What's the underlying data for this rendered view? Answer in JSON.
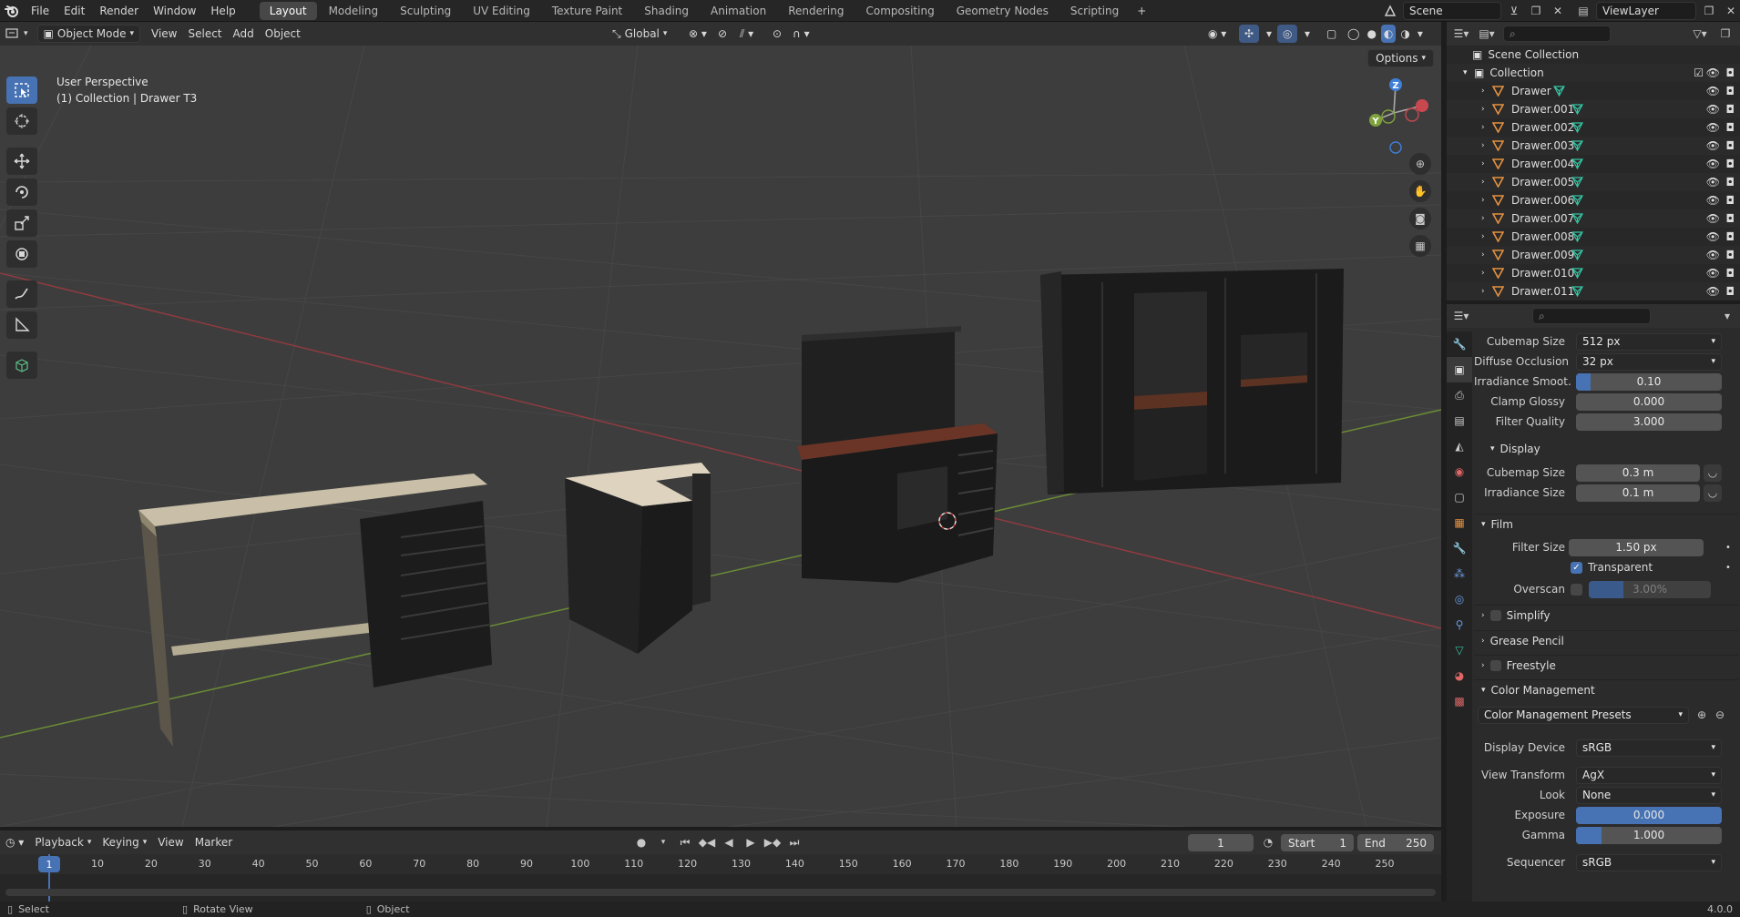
{
  "menubar": {
    "items": [
      "File",
      "Edit",
      "Render",
      "Window",
      "Help"
    ],
    "workspaces": [
      "Layout",
      "Modeling",
      "Sculpting",
      "UV Editing",
      "Texture Paint",
      "Shading",
      "Animation",
      "Rendering",
      "Compositing",
      "Geometry Nodes",
      "Scripting"
    ],
    "active_workspace": "Layout",
    "scene": "Scene",
    "view_layer": "ViewLayer"
  },
  "viewport_header": {
    "mode": "Object Mode",
    "menus": [
      "View",
      "Select",
      "Add",
      "Object"
    ],
    "transform_orientation": "Global",
    "options_label": "Options"
  },
  "viewport": {
    "perspective": "User Perspective",
    "context": "(1) Collection | Drawer T3",
    "gizmo_axes": {
      "x": "X",
      "y": "Y",
      "z": "Z"
    }
  },
  "outliner": {
    "scene_collection": "Scene Collection",
    "collection": "Collection",
    "objects": [
      "Drawer",
      "Drawer.001",
      "Drawer.002",
      "Drawer.003",
      "Drawer.004",
      "Drawer.005",
      "Drawer.006",
      "Drawer.007",
      "Drawer.008",
      "Drawer.009",
      "Drawer.010",
      "Drawer.011"
    ]
  },
  "properties": {
    "indirect_lighting": {
      "cubemap_size_label": "Cubemap Size",
      "cubemap_size_value": "512 px",
      "diffuse_occlusion_label": "Diffuse Occlusion",
      "diffuse_occlusion_value": "32 px",
      "irradiance_smooth_label": "Irradiance Smoot...",
      "irradiance_smooth_value": "0.10",
      "irradiance_smooth_fill": 0.1,
      "clamp_glossy_label": "Clamp Glossy",
      "clamp_glossy_value": "0.000",
      "filter_quality_label": "Filter Quality",
      "filter_quality_value": "3.000"
    },
    "display": {
      "title": "Display",
      "cubemap_size_label": "Cubemap Size",
      "cubemap_size_value": "0.3 m",
      "irradiance_size_label": "Irradiance Size",
      "irradiance_size_value": "0.1 m"
    },
    "film": {
      "title": "Film",
      "filter_size_label": "Filter Size",
      "filter_size_value": "1.50 px",
      "transparent_label": "Transparent",
      "transparent_checked": true,
      "overscan_label": "Overscan",
      "overscan_value": "3.00%"
    },
    "collapsed_sections": [
      "Simplify",
      "Grease Pencil",
      "Freestyle"
    ],
    "color_management": {
      "title": "Color Management",
      "presets_label": "Color Management Presets",
      "display_device_label": "Display Device",
      "display_device_value": "sRGB",
      "view_transform_label": "View Transform",
      "view_transform_value": "AgX",
      "look_label": "Look",
      "look_value": "None",
      "exposure_label": "Exposure",
      "exposure_value": "0.000",
      "gamma_label": "Gamma",
      "gamma_value": "1.000",
      "sequencer_label": "Sequencer",
      "sequencer_value": "sRGB"
    }
  },
  "timeline": {
    "menus": [
      "Playback",
      "Keying",
      "View",
      "Marker"
    ],
    "current_frame": "1",
    "start_label": "Start",
    "start_value": "1",
    "end_label": "End",
    "end_value": "250",
    "ruler": [
      "1",
      "10",
      "20",
      "30",
      "40",
      "50",
      "60",
      "70",
      "80",
      "90",
      "100",
      "110",
      "120",
      "130",
      "140",
      "150",
      "160",
      "170",
      "180",
      "190",
      "200",
      "210",
      "220",
      "230",
      "240",
      "250"
    ]
  },
  "statusbar": {
    "select": "Select",
    "rotate_view": "Rotate View",
    "object": "Object",
    "version": "4.0.0"
  },
  "colors": {
    "accent": "#4772b3",
    "x_axis": "#c9484f",
    "y_axis": "#7fa23c",
    "z_axis": "#3e7fd8",
    "object_orange": "#e49140",
    "mesh_green": "#35c3a2"
  }
}
